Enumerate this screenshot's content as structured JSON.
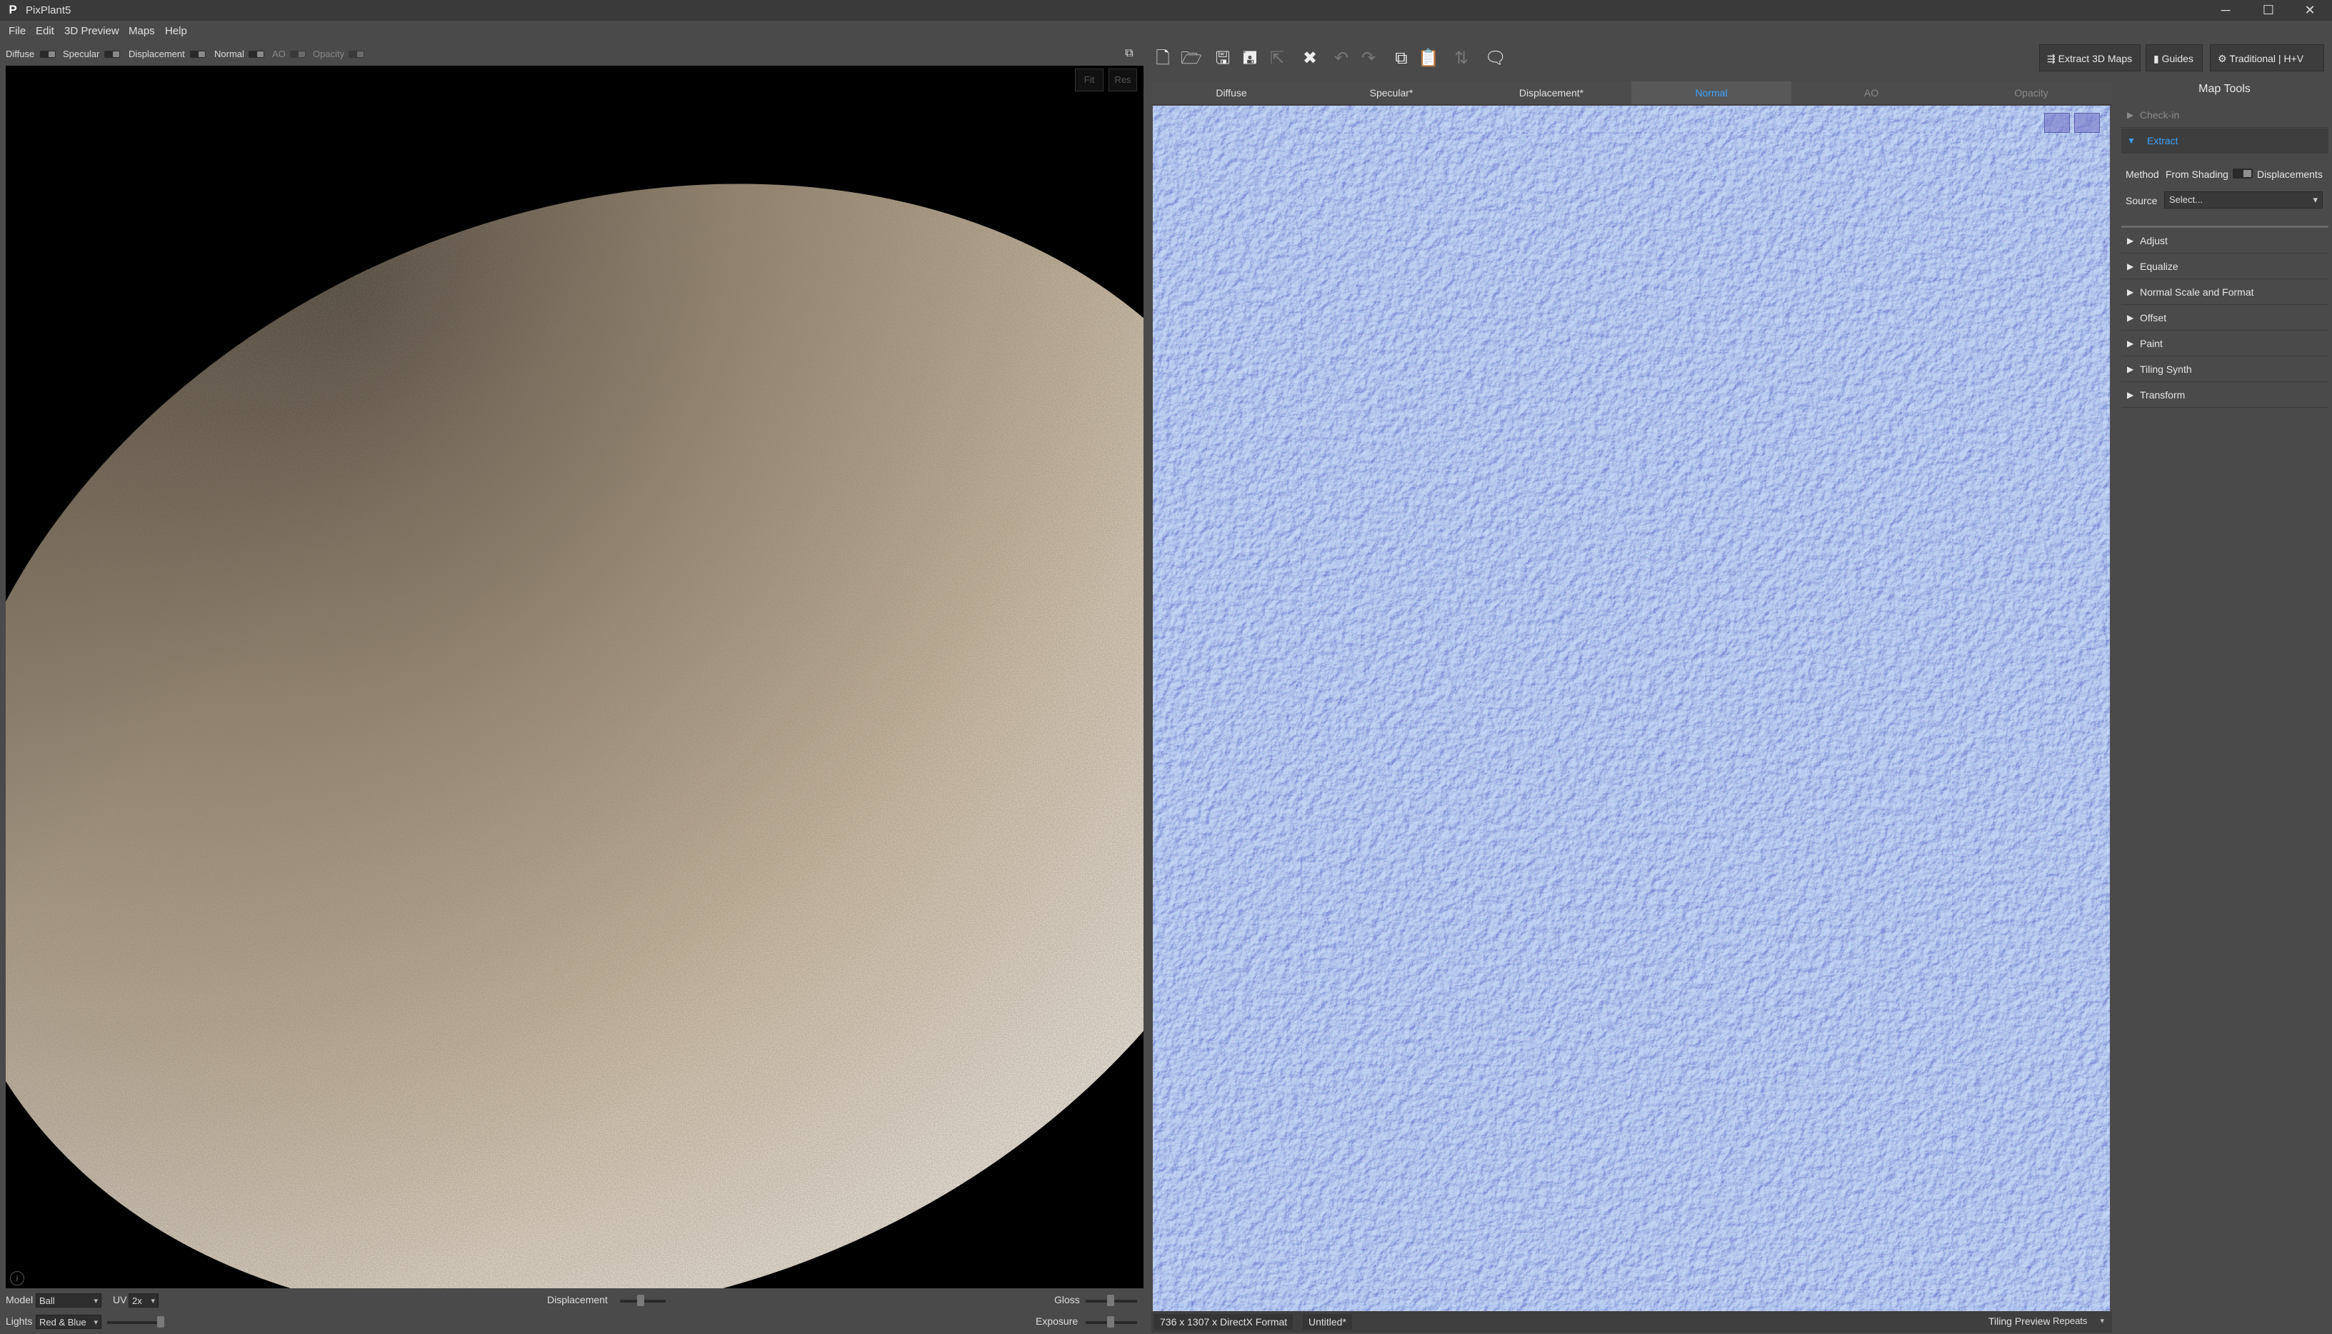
{
  "window": {
    "title": "PixPlant5",
    "logo": "P",
    "controls": {
      "minimize": "─",
      "maximize": "☐",
      "close": "✕"
    }
  },
  "menu": [
    "File",
    "Edit",
    "3D Preview",
    "Maps",
    "Help"
  ],
  "map_toggles": [
    {
      "label": "Diffuse",
      "enabled": true
    },
    {
      "label": "Specular",
      "enabled": true
    },
    {
      "label": "Displacement",
      "enabled": true
    },
    {
      "label": "Normal",
      "enabled": true
    },
    {
      "label": "AO",
      "enabled": false
    },
    {
      "label": "Opacity",
      "enabled": false
    }
  ],
  "viewport": {
    "fit_label": "Fit",
    "res_label": "Res",
    "info_icon": "i"
  },
  "preview_controls": {
    "model_label": "Model",
    "model_value": "Ball",
    "uv_label": "UV",
    "uv_value": "2x",
    "lights_label": "Lights",
    "lights_value": "Red & Blue",
    "displacement_label": "Displacement",
    "gloss_label": "Gloss",
    "exposure_label": "Exposure"
  },
  "toolbar": {
    "right_buttons": {
      "extract": "Extract 3D Maps",
      "guides": "Guides",
      "mode": "Traditional | H+V"
    }
  },
  "tabs": [
    {
      "label": "Diffuse",
      "state": "normal"
    },
    {
      "label": "Specular*",
      "state": "normal"
    },
    {
      "label": "Displacement*",
      "state": "normal"
    },
    {
      "label": "Normal",
      "state": "active"
    },
    {
      "label": "AO",
      "state": "dim"
    },
    {
      "label": "Opacity",
      "state": "dim"
    }
  ],
  "status": {
    "dimensions": "736 x 1307 x DirectX Format",
    "file": "Untitled*",
    "tiling_label": "Tiling Preview",
    "tiling_value": "Repeats"
  },
  "map_tools": {
    "title": "Map Tools",
    "checkin": "Check-in",
    "extract": "Extract",
    "method_label": "Method",
    "method_left": "From Shading",
    "method_right": "Displacements",
    "source_label": "Source",
    "source_value": "Select...",
    "sections": [
      "Adjust",
      "Equalize",
      "Normal Scale and Format",
      "Offset",
      "Paint",
      "Tiling Synth",
      "Transform"
    ]
  },
  "colors": {
    "accent": "#3aa2ff",
    "normal_base": "#7c7de8",
    "panel_bg": "#4a4a4a"
  }
}
